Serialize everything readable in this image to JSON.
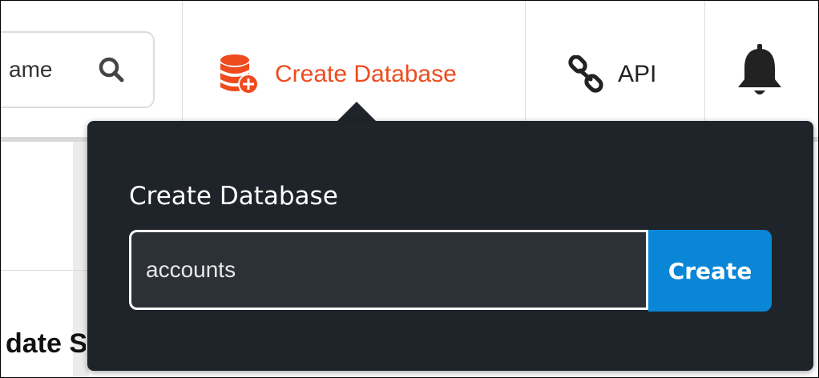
{
  "header": {
    "search": {
      "visible_text": "ame",
      "icon": "search-icon"
    },
    "nav": {
      "create_database_label": "Create Database",
      "create_database_icon": "database-plus-icon",
      "api_label": "API",
      "api_icon": "link-icon",
      "notifications_icon": "bell-icon"
    }
  },
  "background": {
    "heading_fragment": "date S"
  },
  "popover": {
    "title": "Create Database",
    "input_value": "accounts",
    "submit_label": "Create"
  },
  "colors": {
    "accent": "#ee4b1f",
    "primary_button": "#0a86d6",
    "popover_bg": "#1f242b",
    "input_bg": "#2c3137"
  }
}
